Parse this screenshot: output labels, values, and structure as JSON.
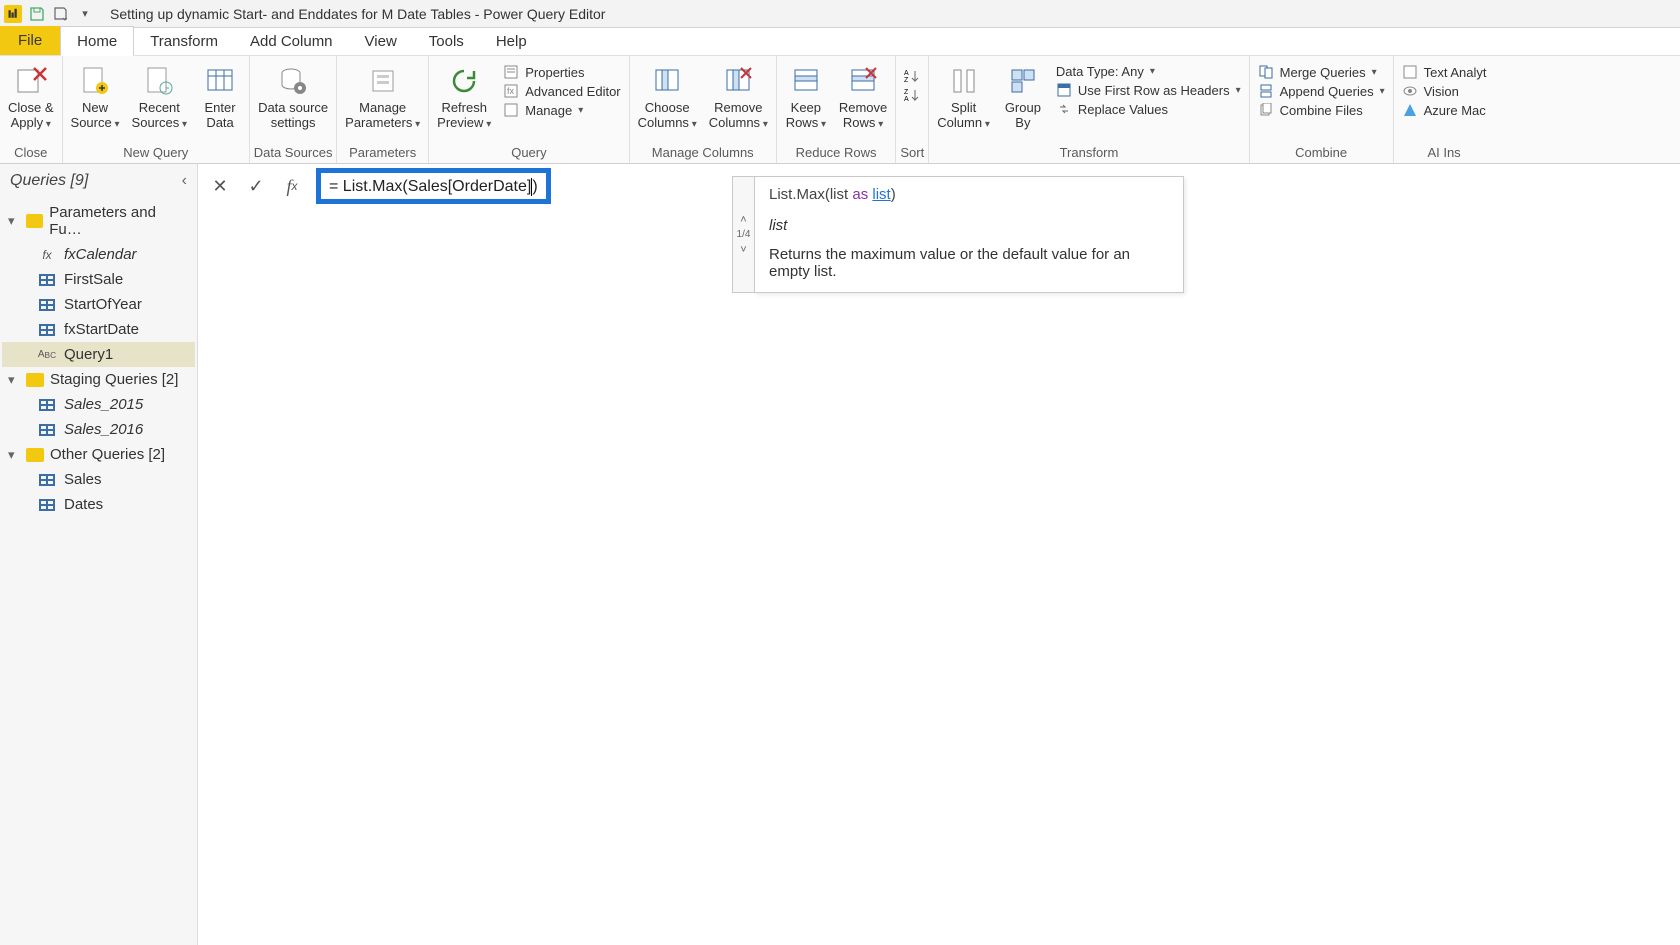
{
  "title": "Setting up dynamic Start- and Enddates for M Date Tables - Power Query Editor",
  "tabs": {
    "file": "File",
    "home": "Home",
    "transform": "Transform",
    "add_column": "Add Column",
    "view": "View",
    "tools": "Tools",
    "help": "Help"
  },
  "ribbon": {
    "close": {
      "close_apply": "Close &\nApply",
      "group": "Close"
    },
    "new_query": {
      "new_source": "New\nSource",
      "recent_sources": "Recent\nSources",
      "enter_data": "Enter\nData",
      "group": "New Query"
    },
    "data_sources": {
      "data_source_settings": "Data source\nsettings",
      "group": "Data Sources"
    },
    "parameters": {
      "manage_parameters": "Manage\nParameters",
      "group": "Parameters"
    },
    "query": {
      "refresh_preview": "Refresh\nPreview",
      "properties": "Properties",
      "advanced_editor": "Advanced Editor",
      "manage": "Manage",
      "group": "Query"
    },
    "manage_columns": {
      "choose_columns": "Choose\nColumns",
      "remove_columns": "Remove\nColumns",
      "group": "Manage Columns"
    },
    "reduce_rows": {
      "keep_rows": "Keep\nRows",
      "remove_rows": "Remove\nRows",
      "group": "Reduce Rows"
    },
    "sort": {
      "group": "Sort"
    },
    "transform": {
      "split_column": "Split\nColumn",
      "group_by": "Group\nBy",
      "data_type": "Data Type: Any",
      "first_row": "Use First Row as Headers",
      "replace_values": "Replace Values",
      "group": "Transform"
    },
    "combine": {
      "merge": "Merge Queries",
      "append": "Append Queries",
      "combine_files": "Combine Files",
      "group": "Combine"
    },
    "ai": {
      "text_analytics": "Text Analyt",
      "vision": "Vision",
      "azure_ml": "Azure Mac",
      "group": "AI Ins"
    }
  },
  "queries_pane": {
    "header": "Queries [9]",
    "group1": "Parameters and Fu…",
    "fxCalendar": "fxCalendar",
    "firstSale": "FirstSale",
    "startOfYear": "StartOfYear",
    "fxStartDate": "fxStartDate",
    "query1": "Query1",
    "group2": "Staging Queries [2]",
    "sales2015": "Sales_2015",
    "sales2016": "Sales_2016",
    "group3": "Other Queries [2]",
    "sales": "Sales",
    "dates": "Dates"
  },
  "formula": {
    "prefix": "= ",
    "fn": "List.Max",
    "open": "(",
    "arg_a": "Sales",
    "arg_b": "[OrderDate]",
    "close": ")"
  },
  "tooltip": {
    "sig_fn": "List.Max",
    "sig_open": "(list ",
    "sig_as": "as",
    "sig_space": " ",
    "sig_list": "list",
    "sig_close": ")",
    "frac": "1/4",
    "param": "list",
    "desc": "Returns the maximum value or the default value for an empty list."
  }
}
